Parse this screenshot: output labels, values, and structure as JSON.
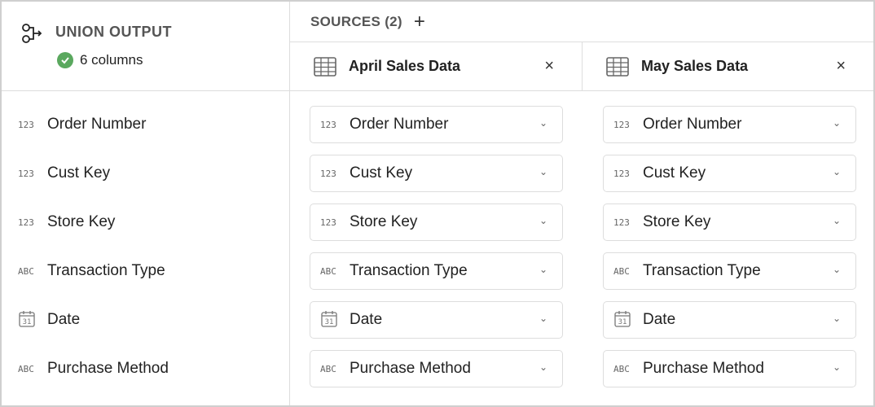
{
  "output": {
    "title": "UNION OUTPUT",
    "status": "6 columns",
    "icon": "union-icon",
    "status_color": "#5aa85e"
  },
  "sources": {
    "title": "SOURCES (2)",
    "add": "+",
    "close": "×",
    "tabs": [
      {
        "name": "April Sales Data",
        "icon": "table-icon"
      },
      {
        "name": "May Sales Data",
        "icon": "table-icon"
      }
    ]
  },
  "columns": [
    {
      "type": "123",
      "name": "Order Number"
    },
    {
      "type": "123",
      "name": "Cust Key"
    },
    {
      "type": "123",
      "name": "Store Key"
    },
    {
      "type": "ABC",
      "name": "Transaction Type"
    },
    {
      "type": "date",
      "name": "Date"
    },
    {
      "type": "ABC",
      "name": "Purchase Method"
    }
  ],
  "mappings": [
    [
      "Order Number",
      "Cust Key",
      "Store Key",
      "Transaction Type",
      "Date",
      "Purchase Method"
    ],
    [
      "Order Number",
      "Cust Key",
      "Store Key",
      "Transaction Type",
      "Date",
      "Purchase Method"
    ]
  ]
}
